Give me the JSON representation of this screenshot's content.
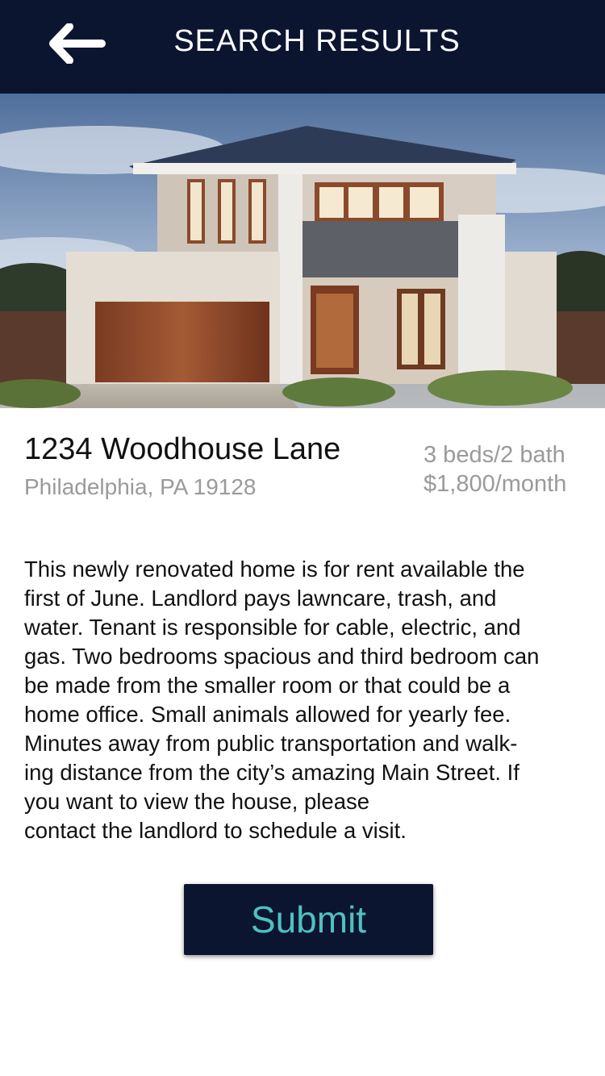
{
  "header": {
    "title": "SEARCH RESULTS",
    "back_icon": "arrow-left-icon"
  },
  "listing": {
    "photo": "house-photo",
    "address": "1234 Woodhouse Lane",
    "city": "Philadelphia, PA 19128",
    "beds_baths": "3 beds/2 bath",
    "price": "$1,800/month",
    "description_lines": [
      "This newly renovated home is for rent available the",
      "first of June. Landlord pays lawncare, trash, and",
      "water. Tenant is responsible for cable, electric, and",
      "gas. Two bedrooms spacious and third bedroom can",
      "be made from the smaller room or that could be a",
      "home office. Small animals allowed for yearly fee.",
      "Minutes away from public transportation and walk-",
      "ing distance from the city’s amazing Main Street. If",
      "you want to view the house, please",
      "contact the landlord to schedule a visit."
    ]
  },
  "actions": {
    "submit_label": "Submit"
  },
  "colors": {
    "header_bg": "#0b1530",
    "button_text": "#4fc1c0",
    "muted_text": "#9a9a9a"
  }
}
